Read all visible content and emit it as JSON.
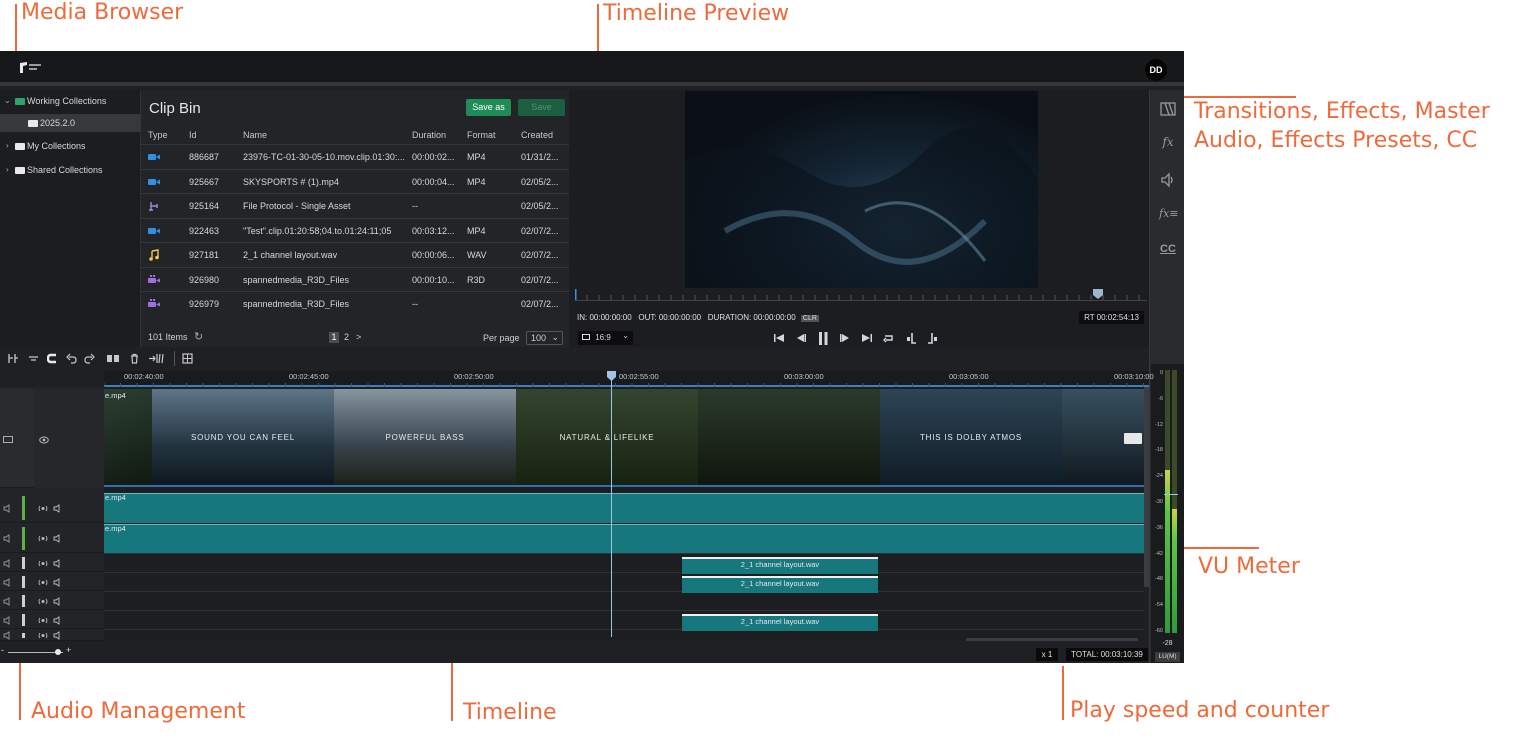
{
  "annotations": {
    "media_browser": "Media Browser",
    "timeline_preview": "Timeline Preview",
    "transitions_line1": "Transitions, Effects, Master",
    "transitions_line2": "Audio, Effects Presets, CC",
    "vu_meter": "VU Meter",
    "audio_management": "Audio Management",
    "timeline": "Timeline",
    "play_speed": "Play speed and counter"
  },
  "header": {
    "avatar_initials": "DD"
  },
  "collections": [
    {
      "label": "Working Collections",
      "expanded": true
    },
    {
      "label": "2025.2.0",
      "selected": true
    },
    {
      "label": "My Collections",
      "expanded": false
    },
    {
      "label": "Shared Collections",
      "expanded": false
    }
  ],
  "clip_bin": {
    "title": "Clip Bin",
    "save_as_label": "Save as",
    "save_label": "Save",
    "columns": [
      "Type",
      "Id",
      "Name",
      "Duration",
      "Format",
      "Created"
    ],
    "rows": [
      {
        "type": "video-icon",
        "id": "886687",
        "name": "23976-TC-01-30-05-10.mov.clip.01:30:...",
        "duration": "00:00:02...",
        "format": "MP4",
        "created": "01/31/2..."
      },
      {
        "type": "video-icon",
        "id": "925667",
        "name": "SKYSPORTS # (1).mp4",
        "duration": "00:00:04...",
        "format": "MP4",
        "created": "02/05/2..."
      },
      {
        "type": "protocol-icon",
        "id": "925164",
        "name": "File Protocol - Single Asset",
        "duration": "--",
        "format": "",
        "created": "02/05/2..."
      },
      {
        "type": "video-icon",
        "id": "922463",
        "name": "\"Test\".clip.01:20:58;04.to.01:24:11;05",
        "duration": "00:03:12...",
        "format": "MP4",
        "created": "02/07/2..."
      },
      {
        "type": "audio-icon",
        "id": "927181",
        "name": "2_1 channel layout.wav",
        "duration": "00:00:06...",
        "format": "WAV",
        "created": "02/07/2..."
      },
      {
        "type": "spanned-icon",
        "id": "926980",
        "name": "spannedmedia_R3D_Files",
        "duration": "00:00:10...",
        "format": "R3D",
        "created": "02/07/2..."
      },
      {
        "type": "spanned-icon",
        "id": "926979",
        "name": "spannedmedia_R3D_Files",
        "duration": "--",
        "format": "",
        "created": "02/07/2..."
      }
    ],
    "footer": {
      "items_count": "101 Items",
      "pages": [
        "1",
        "2"
      ],
      "next": ">",
      "per_page_label": "Per page",
      "per_page_value": "100"
    }
  },
  "preview": {
    "in_tc": "IN: 00:00:00:00",
    "out_tc": "OUT: 00:00:00:00",
    "duration_tc": "DURATION: 00:00:00:00",
    "clr_label": "CLR",
    "rt_tc": "RT 00:02:54:13",
    "aspect_ratio": "16:9"
  },
  "right_sidebar": [
    "transitions-icon",
    "effects-icon",
    "master-audio-icon",
    "effects-presets-icon",
    "closed-captions-icon"
  ],
  "vu_meter": {
    "scale": [
      "0",
      "-6",
      "-12",
      "-18",
      "-24",
      "-30",
      "-36",
      "-42",
      "-48",
      "-54",
      "-60"
    ],
    "level_left": 0.62,
    "level_right": 0.47,
    "reading": "-28",
    "unit": "LU(M)"
  },
  "timeline": {
    "ruler_labels": [
      "00:02:40:00",
      "00:02:45:00",
      "00:02:50:00",
      "00:02:55:00",
      "00:03:00:00",
      "00:03:05:00",
      "00:03:10:00"
    ],
    "video_clip_name": "e.mp4",
    "audio_clip_1_name": "e.mp4",
    "audio_clip_2_name": "e.mp4",
    "video_thumbs": [
      {
        "text": ""
      },
      {
        "text": "SOUND YOU CAN FEEL"
      },
      {
        "text": "POWERFUL BASS"
      },
      {
        "text": "NATURAL & LIFELIKE"
      },
      {
        "text": ""
      },
      {
        "text": "THIS IS DOLBY ATMOS"
      },
      {
        "text": ""
      }
    ],
    "small_clips": [
      "2_1 channel layout.wav",
      "2_1 channel layout.wav",
      "2_1 channel layout.wav"
    ],
    "zoom_minus": "-",
    "zoom_plus": "+",
    "play_speed": "x 1",
    "total": "TOTAL: 00:03:10:39"
  },
  "colors": {
    "accent_orange": "#ef6a3a",
    "save_green": "#1f8b55",
    "audio_teal": "#16777d",
    "playhead": "#9fc4e6",
    "background": "#1f2023"
  }
}
